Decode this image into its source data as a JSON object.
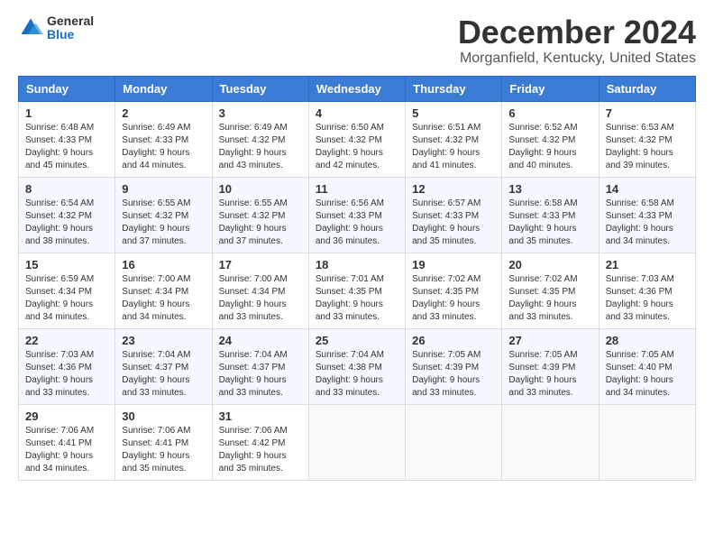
{
  "logo": {
    "general": "General",
    "blue": "Blue"
  },
  "title": "December 2024",
  "location": "Morganfield, Kentucky, United States",
  "headers": [
    "Sunday",
    "Monday",
    "Tuesday",
    "Wednesday",
    "Thursday",
    "Friday",
    "Saturday"
  ],
  "weeks": [
    [
      {
        "day": "1",
        "sunrise": "6:48 AM",
        "sunset": "4:33 PM",
        "daylight": "9 hours and 45 minutes."
      },
      {
        "day": "2",
        "sunrise": "6:49 AM",
        "sunset": "4:33 PM",
        "daylight": "9 hours and 44 minutes."
      },
      {
        "day": "3",
        "sunrise": "6:49 AM",
        "sunset": "4:32 PM",
        "daylight": "9 hours and 43 minutes."
      },
      {
        "day": "4",
        "sunrise": "6:50 AM",
        "sunset": "4:32 PM",
        "daylight": "9 hours and 42 minutes."
      },
      {
        "day": "5",
        "sunrise": "6:51 AM",
        "sunset": "4:32 PM",
        "daylight": "9 hours and 41 minutes."
      },
      {
        "day": "6",
        "sunrise": "6:52 AM",
        "sunset": "4:32 PM",
        "daylight": "9 hours and 40 minutes."
      },
      {
        "day": "7",
        "sunrise": "6:53 AM",
        "sunset": "4:32 PM",
        "daylight": "9 hours and 39 minutes."
      }
    ],
    [
      {
        "day": "8",
        "sunrise": "6:54 AM",
        "sunset": "4:32 PM",
        "daylight": "9 hours and 38 minutes."
      },
      {
        "day": "9",
        "sunrise": "6:55 AM",
        "sunset": "4:32 PM",
        "daylight": "9 hours and 37 minutes."
      },
      {
        "day": "10",
        "sunrise": "6:55 AM",
        "sunset": "4:32 PM",
        "daylight": "9 hours and 37 minutes."
      },
      {
        "day": "11",
        "sunrise": "6:56 AM",
        "sunset": "4:33 PM",
        "daylight": "9 hours and 36 minutes."
      },
      {
        "day": "12",
        "sunrise": "6:57 AM",
        "sunset": "4:33 PM",
        "daylight": "9 hours and 35 minutes."
      },
      {
        "day": "13",
        "sunrise": "6:58 AM",
        "sunset": "4:33 PM",
        "daylight": "9 hours and 35 minutes."
      },
      {
        "day": "14",
        "sunrise": "6:58 AM",
        "sunset": "4:33 PM",
        "daylight": "9 hours and 34 minutes."
      }
    ],
    [
      {
        "day": "15",
        "sunrise": "6:59 AM",
        "sunset": "4:34 PM",
        "daylight": "9 hours and 34 minutes."
      },
      {
        "day": "16",
        "sunrise": "7:00 AM",
        "sunset": "4:34 PM",
        "daylight": "9 hours and 34 minutes."
      },
      {
        "day": "17",
        "sunrise": "7:00 AM",
        "sunset": "4:34 PM",
        "daylight": "9 hours and 33 minutes."
      },
      {
        "day": "18",
        "sunrise": "7:01 AM",
        "sunset": "4:35 PM",
        "daylight": "9 hours and 33 minutes."
      },
      {
        "day": "19",
        "sunrise": "7:02 AM",
        "sunset": "4:35 PM",
        "daylight": "9 hours and 33 minutes."
      },
      {
        "day": "20",
        "sunrise": "7:02 AM",
        "sunset": "4:35 PM",
        "daylight": "9 hours and 33 minutes."
      },
      {
        "day": "21",
        "sunrise": "7:03 AM",
        "sunset": "4:36 PM",
        "daylight": "9 hours and 33 minutes."
      }
    ],
    [
      {
        "day": "22",
        "sunrise": "7:03 AM",
        "sunset": "4:36 PM",
        "daylight": "9 hours and 33 minutes."
      },
      {
        "day": "23",
        "sunrise": "7:04 AM",
        "sunset": "4:37 PM",
        "daylight": "9 hours and 33 minutes."
      },
      {
        "day": "24",
        "sunrise": "7:04 AM",
        "sunset": "4:37 PM",
        "daylight": "9 hours and 33 minutes."
      },
      {
        "day": "25",
        "sunrise": "7:04 AM",
        "sunset": "4:38 PM",
        "daylight": "9 hours and 33 minutes."
      },
      {
        "day": "26",
        "sunrise": "7:05 AM",
        "sunset": "4:39 PM",
        "daylight": "9 hours and 33 minutes."
      },
      {
        "day": "27",
        "sunrise": "7:05 AM",
        "sunset": "4:39 PM",
        "daylight": "9 hours and 33 minutes."
      },
      {
        "day": "28",
        "sunrise": "7:05 AM",
        "sunset": "4:40 PM",
        "daylight": "9 hours and 34 minutes."
      }
    ],
    [
      {
        "day": "29",
        "sunrise": "7:06 AM",
        "sunset": "4:41 PM",
        "daylight": "9 hours and 34 minutes."
      },
      {
        "day": "30",
        "sunrise": "7:06 AM",
        "sunset": "4:41 PM",
        "daylight": "9 hours and 35 minutes."
      },
      {
        "day": "31",
        "sunrise": "7:06 AM",
        "sunset": "4:42 PM",
        "daylight": "9 hours and 35 minutes."
      },
      null,
      null,
      null,
      null
    ]
  ]
}
